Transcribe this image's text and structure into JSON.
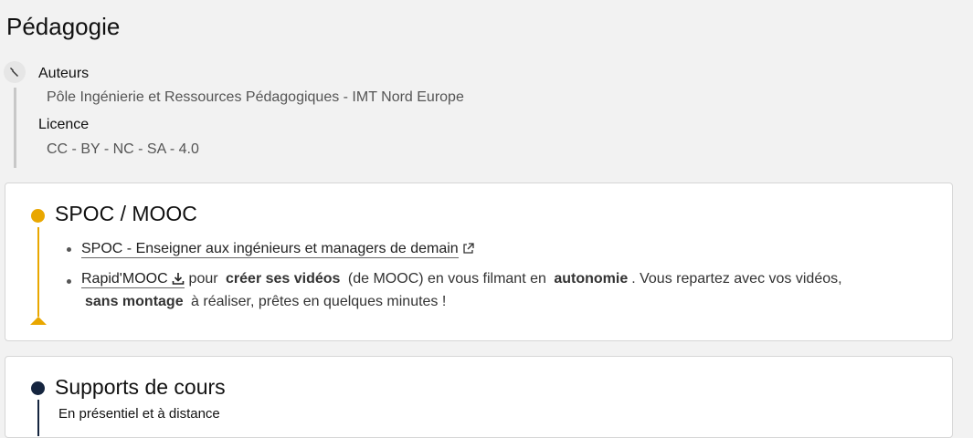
{
  "page": {
    "title": "Pédagogie"
  },
  "meta": {
    "authors_label": "Auteurs",
    "authors_value": "Pôle Ingénierie et Ressources Pédagogiques - IMT Nord Europe",
    "license_label": "Licence",
    "license_value": "CC - BY - NC - SA - 4.0",
    "icon": "wrench-icon"
  },
  "spoc": {
    "title": "SPOC / MOOC",
    "color": "#e9a700",
    "item1": {
      "link": "SPOC - Enseigner aux ingénieurs et managers de demain",
      "icon": "external-link-icon"
    },
    "item2": {
      "link": "Rapid'MOOC",
      "icon": "download-icon",
      "t1": "pour",
      "s1": "créer ses vidéos",
      "t2": "(de MOOC) en vous filmant en",
      "s2": "autonomie",
      "t3": ". Vous repartez avec vos vidéos,",
      "s3": "sans montage",
      "t4": "à réaliser, prêtes en quelques minutes !"
    }
  },
  "supports": {
    "title": "Supports de cours",
    "color": "#15253f",
    "subtitle": "En présentiel et à distance"
  }
}
